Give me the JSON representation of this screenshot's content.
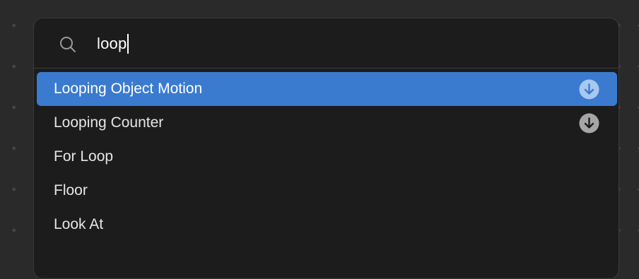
{
  "search": {
    "query": "loop"
  },
  "results": [
    {
      "label": "Looping Object Motion",
      "selected": true,
      "download_icon": "download-circle-icon"
    },
    {
      "label": "Looping Counter",
      "selected": false,
      "download_icon": "download-circle-icon"
    },
    {
      "label": "For Loop",
      "selected": false
    },
    {
      "label": "Floor",
      "selected": false
    },
    {
      "label": "Look At",
      "selected": false
    }
  ],
  "colors": {
    "selected_background": "#3a7bd0",
    "panel_background": "#1c1c1c",
    "canvas_background": "#2a2a2a"
  }
}
